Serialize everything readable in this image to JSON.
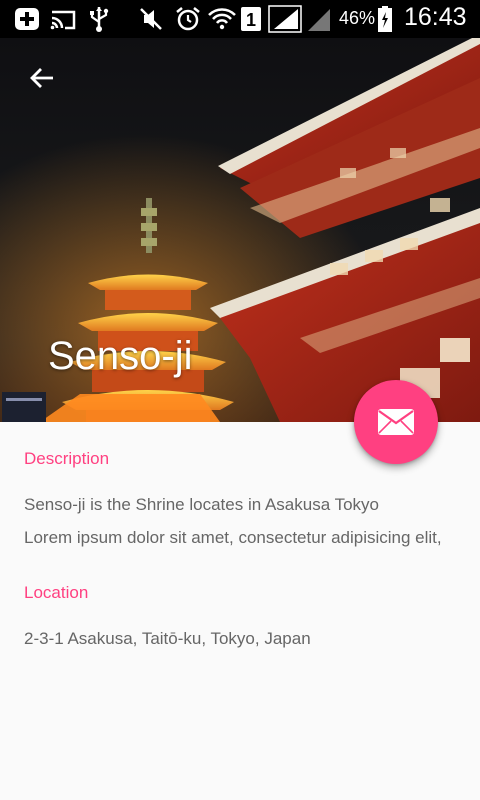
{
  "status_bar": {
    "battery_percent": "46%",
    "time": "16:43",
    "sim_slot": "1",
    "icons": [
      "add-icon",
      "cast-icon",
      "usb-icon",
      "mute-icon",
      "alarm-icon",
      "wifi-icon",
      "sim-icon",
      "signal-icon",
      "signal-icon",
      "battery-icon"
    ]
  },
  "header": {
    "title": "Senso-ji",
    "back_icon": "arrow-back-icon"
  },
  "fab": {
    "icon": "mail-icon",
    "color": "#ff4081"
  },
  "sections": {
    "description": {
      "heading": "Description",
      "lines": [
        "Senso-ji is the Shrine locates in Asakusa Tokyo",
        "Lorem ipsum dolor sit amet, consectetur adipisicing elit,"
      ]
    },
    "location": {
      "heading": "Location",
      "address": "2-3-1 Asakusa, Taitō-ku, Tokyo, Japan"
    }
  },
  "theme": {
    "accent": "#ff4081",
    "body_text": "#666666",
    "background": "#fafafa"
  }
}
